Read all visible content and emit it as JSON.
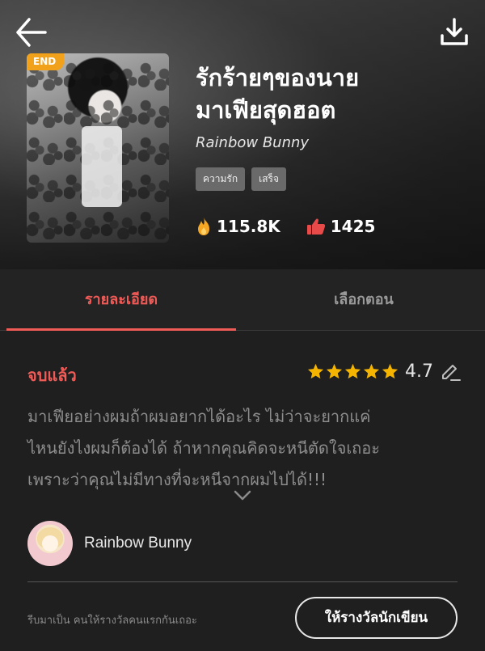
{
  "header": {
    "back_icon": "arrow-left-icon",
    "download_icon": "download-icon"
  },
  "book": {
    "badge": "END",
    "title_line1": "รักร้ายๆของนาย",
    "title_line2": "มาเฟียสุดฮอต",
    "author": "Rainbow Bunny",
    "tags": [
      "ความรัก",
      "เสร็จ"
    ],
    "views": "115.8K",
    "likes": "1425",
    "colors": {
      "badge": "#f2a21a",
      "accent": "#f05b57",
      "fire": "#f5a623",
      "like": "#e84a4a",
      "star": "#f5b400"
    }
  },
  "tabs": [
    {
      "label": "รายละเอียด",
      "active": true
    },
    {
      "label": "เลือกตอน",
      "active": false
    }
  ],
  "details": {
    "status": "จบแล้ว",
    "rating": "4.7",
    "stars": 5,
    "synopsis_line1": "มาเฟียอย่างผมถ้าผมอยากได้อะไร ไม่ว่าจะยากแค่",
    "synopsis_line2": "ไหนยังไงผมก็ต้องได้ ถ้าหากคุณคิดจะหนีตัดใจเถอะ",
    "synopsis_line3": "เพราะว่าคุณไม่มีทางที่จะหนีจากผมไปได้!!!",
    "author_name": "Rainbow Bunny"
  },
  "footer": {
    "prompt": "รีบมาเป็น คนให้รางวัลคนแรกกันเถอะ",
    "reward_button": "ให้รางวัลนักเขียน"
  }
}
